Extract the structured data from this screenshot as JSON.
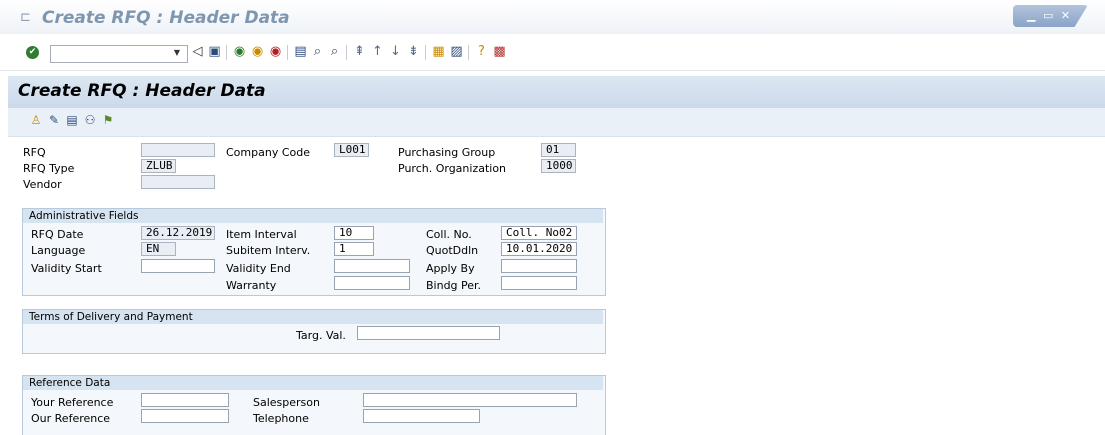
{
  "window": {
    "title": "Create RFQ : Header Data",
    "controls": "▁ ▭ ✕"
  },
  "toolbar": {
    "command_value": ""
  },
  "header": {
    "title": "Create RFQ : Header Data"
  },
  "main": {
    "rfq_label": "RFQ",
    "rfq_value": "",
    "rfq_type_label": "RFQ Type",
    "rfq_type_value": "ZLUB",
    "vendor_label": "Vendor",
    "vendor_value": "",
    "company_code_label": "Company Code",
    "company_code_value": "L001",
    "purch_group_label": "Purchasing Group",
    "purch_group_value": "01",
    "purch_org_label": "Purch. Organization",
    "purch_org_value": "1000"
  },
  "admin": {
    "title": "Administrative Fields",
    "rfq_date_label": "RFQ Date",
    "rfq_date_value": "26.12.2019",
    "language_label": "Language",
    "language_value": "EN",
    "validity_start_label": "Validity Start",
    "validity_start_value": "",
    "item_interval_label": "Item Interval",
    "item_interval_value": "10",
    "subitem_label": "Subitem Interv.",
    "subitem_value": "1",
    "validity_end_label": "Validity End",
    "validity_end_value": "",
    "warranty_label": "Warranty",
    "warranty_value": "",
    "coll_no_label": "Coll. No.",
    "coll_no_value": "Coll. No02",
    "quotddln_label": "QuotDdln",
    "quotddln_value": "10.01.2020",
    "apply_by_label": "Apply By",
    "apply_by_value": "",
    "bindg_label": "Bindg Per.",
    "bindg_value": ""
  },
  "terms": {
    "title": "Terms of Delivery and Payment",
    "targ_val_label": "Targ. Val.",
    "targ_val_value": ""
  },
  "reference": {
    "title": "Reference Data",
    "your_ref_label": "Your Reference",
    "your_ref_value": "",
    "our_ref_label": "Our Reference",
    "our_ref_value": "",
    "salesperson_label": "Salesperson",
    "salesperson_value": "",
    "telephone_label": "Telephone",
    "telephone_value": ""
  }
}
